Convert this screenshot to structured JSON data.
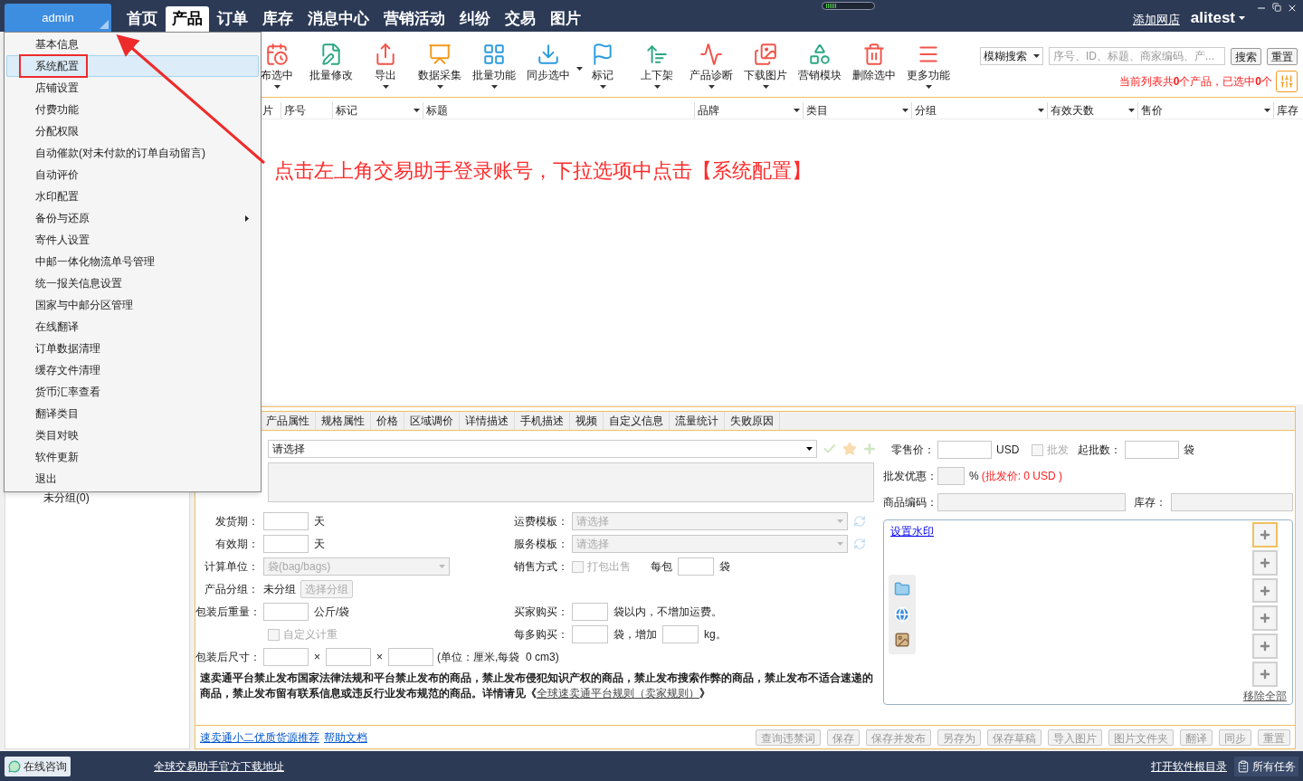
{
  "account": {
    "name": "admin"
  },
  "nav": [
    {
      "label": "首页",
      "selected": false
    },
    {
      "label": "产品",
      "selected": true
    },
    {
      "label": "订单",
      "selected": false
    },
    {
      "label": "库存",
      "selected": false
    },
    {
      "label": "消息中心",
      "selected": false
    },
    {
      "label": "营销活动",
      "selected": false
    },
    {
      "label": "纠纷",
      "selected": false
    },
    {
      "label": "交易",
      "selected": false
    },
    {
      "label": "图片",
      "selected": false
    }
  ],
  "header": {
    "add_shop": "添加网店",
    "user": "alitest"
  },
  "menu": {
    "items": [
      {
        "label": "基本信息",
        "selected": false,
        "submenu": false
      },
      {
        "label": "系统配置",
        "selected": true,
        "submenu": false
      },
      {
        "label": "店铺设置",
        "selected": false,
        "submenu": false
      },
      {
        "label": "付费功能",
        "selected": false,
        "submenu": false
      },
      {
        "label": "分配权限",
        "selected": false,
        "submenu": false
      },
      {
        "label": "自动催款(对未付款的订单自动留言)",
        "selected": false,
        "submenu": false
      },
      {
        "label": "自动评价",
        "selected": false,
        "submenu": false
      },
      {
        "label": "水印配置",
        "selected": false,
        "submenu": false
      },
      {
        "label": "备份与还原",
        "selected": false,
        "submenu": true
      },
      {
        "label": "寄件人设置",
        "selected": false,
        "submenu": false
      },
      {
        "label": "中邮一体化物流单号管理",
        "selected": false,
        "submenu": false
      },
      {
        "label": "统一报关信息设置",
        "selected": false,
        "submenu": false
      },
      {
        "label": "国家与中邮分区管理",
        "selected": false,
        "submenu": false
      },
      {
        "label": "在线翻译",
        "selected": false,
        "submenu": false
      },
      {
        "label": "订单数据清理",
        "selected": false,
        "submenu": false
      },
      {
        "label": "缓存文件清理",
        "selected": false,
        "submenu": false
      },
      {
        "label": "货币汇率查看",
        "selected": false,
        "submenu": false
      },
      {
        "label": "翻译类目",
        "selected": false,
        "submenu": false
      },
      {
        "label": "类目对映",
        "selected": false,
        "submenu": false
      },
      {
        "label": "软件更新",
        "selected": false,
        "submenu": false
      },
      {
        "label": "退出",
        "selected": false,
        "submenu": false
      }
    ]
  },
  "toolbar": [
    {
      "label": "布选中",
      "kind": "dropdown"
    },
    {
      "label": "批量修改",
      "kind": "plain"
    },
    {
      "label": "导出",
      "kind": "dropdown"
    },
    {
      "label": "数据采集",
      "kind": "dropdown"
    },
    {
      "label": "批量功能",
      "kind": "dropdown"
    },
    {
      "label": "同步选中",
      "kind": "split"
    },
    {
      "label": "标记",
      "kind": "dropdown"
    },
    {
      "label": "上下架",
      "kind": "dropdown"
    },
    {
      "label": "产品诊断",
      "kind": "dropdown"
    },
    {
      "label": "下载图片",
      "kind": "dropdown"
    },
    {
      "label": "营销模块",
      "kind": "plain"
    },
    {
      "label": "删除选中",
      "kind": "plain"
    },
    {
      "label": "更多功能",
      "kind": "dropdown"
    }
  ],
  "search": {
    "mode": "模糊搜索",
    "placeholder": "序号、ID、标题、商家编码、产...",
    "buttons": [
      "搜索",
      "重置"
    ]
  },
  "summary": "当前列表共**0**个产品，已选中**0**个",
  "table": {
    "columns": [
      {
        "label": "片",
        "filter": false
      },
      {
        "label": "序号",
        "filter": false
      },
      {
        "label": "标记",
        "filter": true
      },
      {
        "label": "标题",
        "filter": false
      },
      {
        "label": "品牌",
        "filter": true
      },
      {
        "label": "类目",
        "filter": true
      },
      {
        "label": "分组",
        "filter": true
      },
      {
        "label": "有效天数",
        "filter": true
      },
      {
        "label": "售价",
        "filter": true
      },
      {
        "label": "库存",
        "filter": false
      }
    ]
  },
  "annotation": "点击左上角交易助手登录账号，下拉选项中点击【系统配置】",
  "sidebar": {
    "items": [
      "未分组(0)"
    ]
  },
  "detail_tabs": [
    "产品属性",
    "规格属性",
    "价格",
    "区域调价",
    "详情描述",
    "手机描述",
    "视频",
    "自定义信息",
    "流量统计",
    "失败原因"
  ],
  "form": {
    "category": {
      "value": "请选择"
    },
    "shipping_days": {
      "label": "发货期：",
      "unit": "天"
    },
    "valid_days": {
      "label": "有效期：",
      "unit": "天"
    },
    "freight_template": {
      "label": "运费模板：",
      "placeholder": "请选择"
    },
    "service_template": {
      "label": "服务模板：",
      "placeholder": "请选择"
    },
    "unit": {
      "label": "计算单位：",
      "placeholder": "袋(bag/bags)"
    },
    "sale_mode": {
      "label": "销售方式：",
      "option": "打包出售",
      "checked": false,
      "per_pack": "每包",
      "unit": "袋"
    },
    "group": {
      "label": "产品分组：",
      "value": "未分组",
      "button": "选择分组"
    },
    "weight": {
      "label": "包装后重量：",
      "unit": "公斤/袋"
    },
    "buyer_buy": {
      "label": "买家购买：",
      "suffix": "袋以内，不增加运费。"
    },
    "custom_weight": {
      "label": "自定义计重",
      "checked": false
    },
    "each_more": {
      "label": "每多购买：",
      "mid": "袋，增加",
      "unit": "kg。"
    },
    "size": {
      "label": "包装后尺寸：",
      "sep": [
        "×",
        "×"
      ],
      "note": "(单位：厘米,每袋  0 cm3)"
    },
    "notice": "速卖通平台禁止发布国家法律法规和平台禁止发布的商品，禁止发布侵犯知识产权的商品，禁止发布搜索作弊的商品，禁止发布不适合速递的商品，禁止发布留有联系信息或违反行业发布规范的商品。详情请见《",
    "notice_link": "全球速卖通平台规则（卖家规则）",
    "notice_end": "》"
  },
  "pricing": {
    "retail": {
      "label": "零售价：",
      "unit": "USD"
    },
    "wholesale": {
      "label": "批发",
      "checked": false
    },
    "min_qty": {
      "label": "起批数：",
      "unit": "袋"
    },
    "discount": {
      "label": "批发优惠：",
      "unit": "%",
      "note": "(批发价: 0 USD )"
    },
    "sku": {
      "label": "商品编码："
    },
    "stock": {
      "label": "库存："
    }
  },
  "images": {
    "watermark_link": "设置水印",
    "remove_all": "移除全部",
    "slots": [
      {
        "selected": true
      },
      {
        "selected": false
      },
      {
        "selected": false
      },
      {
        "selected": false
      },
      {
        "selected": false
      },
      {
        "selected": false
      }
    ]
  },
  "footer": {
    "links": [
      "速卖通小二优质货源推荐",
      "帮助文档"
    ],
    "buttons": [
      "查询违禁词",
      "保存",
      "保存并发布",
      "另存为",
      "保存草稿",
      "导入图片",
      "图片文件夹",
      "翻译",
      "同步",
      "重置"
    ]
  },
  "status_bar": {
    "chat": "在线咨询",
    "download_link": "全球交易助手官方下载地址",
    "open_dir": "打开软件根目录",
    "tasks": "所有任务"
  }
}
